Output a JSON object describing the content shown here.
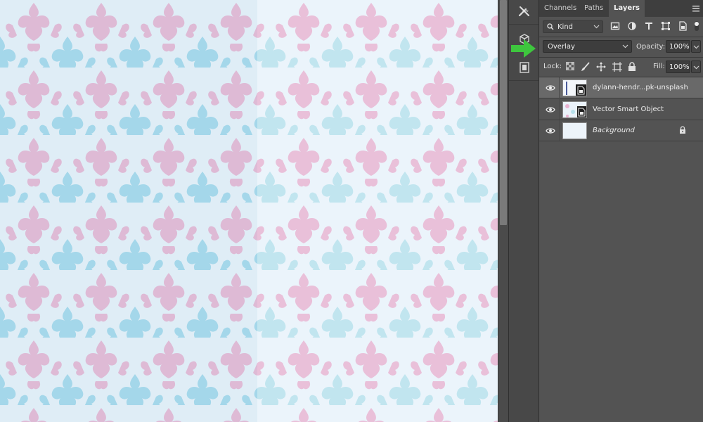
{
  "panel": {
    "tabs": [
      {
        "label": "Channels",
        "active": false
      },
      {
        "label": "Paths",
        "active": false
      },
      {
        "label": "Layers",
        "active": true
      }
    ]
  },
  "filter": {
    "kind_label": "Kind",
    "icons": [
      "image-filter-icon",
      "adjustment-filter-icon",
      "type-filter-icon",
      "shape-filter-icon",
      "smart-object-filter-icon",
      "filter-toggle-icon"
    ]
  },
  "blend": {
    "mode": "Overlay",
    "opacity_label": "Opacity:",
    "opacity_value": "100%"
  },
  "lock": {
    "label": "Lock:",
    "icons": [
      "lock-transparent-pixels-icon",
      "lock-image-pixels-icon",
      "lock-position-icon",
      "lock-artboard-icon",
      "lock-all-icon"
    ],
    "fill_label": "Fill:",
    "fill_value": "100%"
  },
  "layers": [
    {
      "name": "dylann-hendr...pk-unsplash",
      "selected": true,
      "visible": true,
      "italic": false,
      "locked": false
    },
    {
      "name": "Vector Smart Object",
      "selected": false,
      "visible": true,
      "italic": false,
      "locked": false
    },
    {
      "name": "Background",
      "selected": false,
      "visible": true,
      "italic": true,
      "locked": true
    }
  ],
  "colors": {
    "pattern_pink": "#e5a3c8",
    "pattern_blue": "#8fd0e6",
    "canvas_bg": "#e6f1f9",
    "callout_arrow": "#3ec63e"
  }
}
